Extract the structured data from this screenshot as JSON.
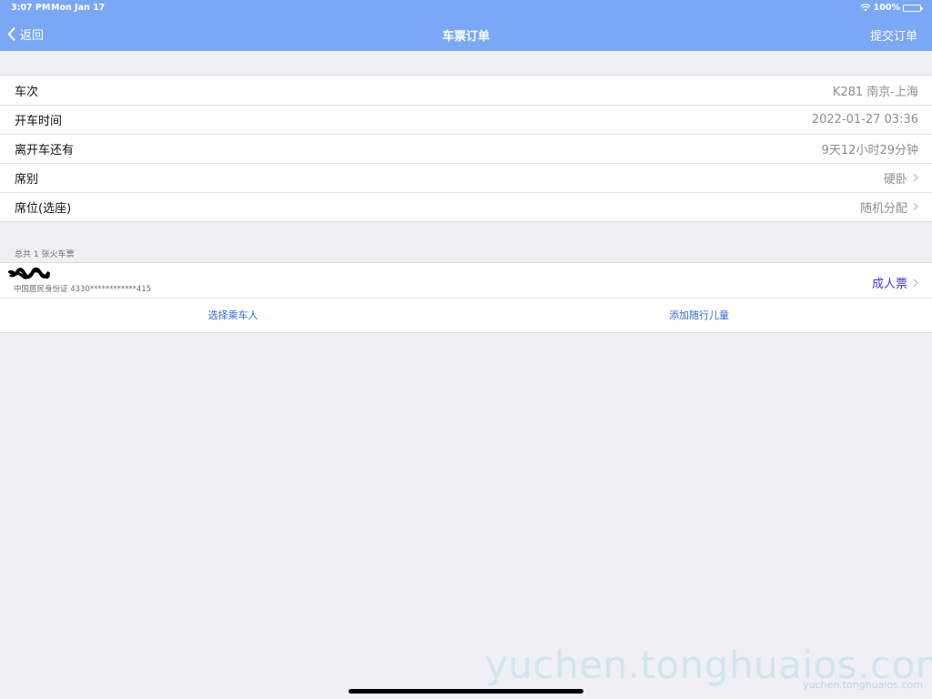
{
  "status_bar": {
    "time": "3:07 PM",
    "date": "Mon Jan 17",
    "battery": "100%"
  },
  "nav": {
    "back_label": "返回",
    "title": "车票订单",
    "submit_label": "提交订单"
  },
  "details": [
    {
      "label": "车次",
      "value": "K281 南京-上海",
      "has_chevron": false
    },
    {
      "label": "开车时间",
      "value": "2022-01-27 03:36",
      "has_chevron": false
    },
    {
      "label": "离开车还有",
      "value": "9天12小时29分钟",
      "has_chevron": false
    },
    {
      "label": "席别",
      "value": "硬卧",
      "has_chevron": true
    },
    {
      "label": "席位(选座)",
      "value": "随机分配",
      "has_chevron": true
    }
  ],
  "tickets_note": "总共 1 张火车票",
  "passenger": {
    "id_text": "中国居民身份证 4330************415",
    "ticket_type": "成人票"
  },
  "actions": {
    "select_passenger": "选择乘车人",
    "add_child": "添加随行儿童"
  },
  "watermark": {
    "large": "yuchen.tonghuaios.com",
    "small": "yuchen.tonghuaios.com"
  },
  "colors": {
    "nav_bar": "#7aa8f6",
    "ticket_type": "#4a36d6",
    "action_link": "#2f6fd8",
    "background": "#efeff4"
  }
}
